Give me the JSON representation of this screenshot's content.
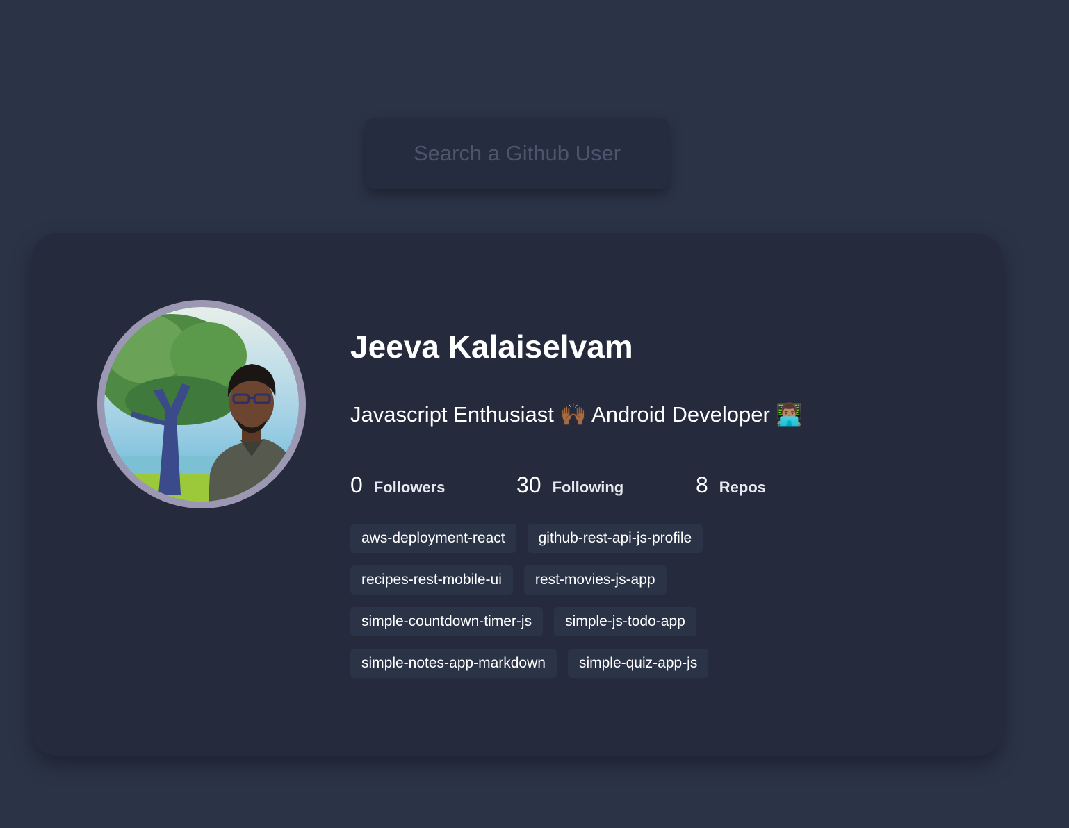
{
  "search": {
    "placeholder": "Search a Github User",
    "value": ""
  },
  "profile": {
    "name": "Jeeva Kalaiselvam",
    "bio": "Javascript Enthusiast 🙌🏾 Android Developer 👨🏽‍💻",
    "stats": {
      "followers": {
        "count": "0",
        "label": "Followers"
      },
      "following": {
        "count": "30",
        "label": "Following"
      },
      "repos": {
        "count": "8",
        "label": "Repos"
      }
    },
    "repos": [
      "aws-deployment-react",
      "github-rest-api-js-profile",
      "recipes-rest-mobile-ui",
      "rest-movies-js-app",
      "simple-countdown-timer-js",
      "simple-js-todo-app",
      "simple-notes-app-markdown",
      "simple-quiz-app-js"
    ]
  },
  "colors": {
    "background": "#2b3347",
    "card": "#252b3d",
    "avatar_border": "#9c97b2",
    "repo_chip": "#2b3347"
  }
}
